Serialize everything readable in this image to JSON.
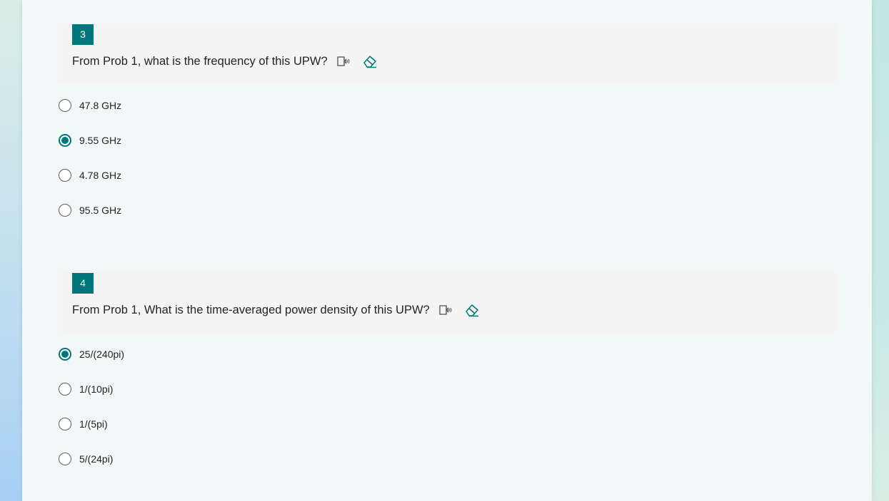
{
  "questions": [
    {
      "number": "3",
      "title": "From Prob 1, what is the frequency of this UPW?",
      "options": [
        {
          "label": "47.8 GHz",
          "selected": false
        },
        {
          "label": "9.55 GHz",
          "selected": true
        },
        {
          "label": "4.78 GHz",
          "selected": false
        },
        {
          "label": "95.5 GHz",
          "selected": false
        }
      ]
    },
    {
      "number": "4",
      "title": "From Prob 1, What is the time-averaged power density of this UPW?",
      "options": [
        {
          "label": "25/(240pi)",
          "selected": true
        },
        {
          "label": "1/(10pi)",
          "selected": false
        },
        {
          "label": "1/(5pi)",
          "selected": false
        },
        {
          "label": "5/(24pi)",
          "selected": false
        }
      ]
    }
  ],
  "colors": {
    "accent": "#00757a",
    "question_header_bg": "#f4f4f4",
    "card_bg": "#f2f7f8"
  },
  "icons": {
    "read_aloud": "immersive-reader-icon",
    "clear": "eraser-icon"
  }
}
